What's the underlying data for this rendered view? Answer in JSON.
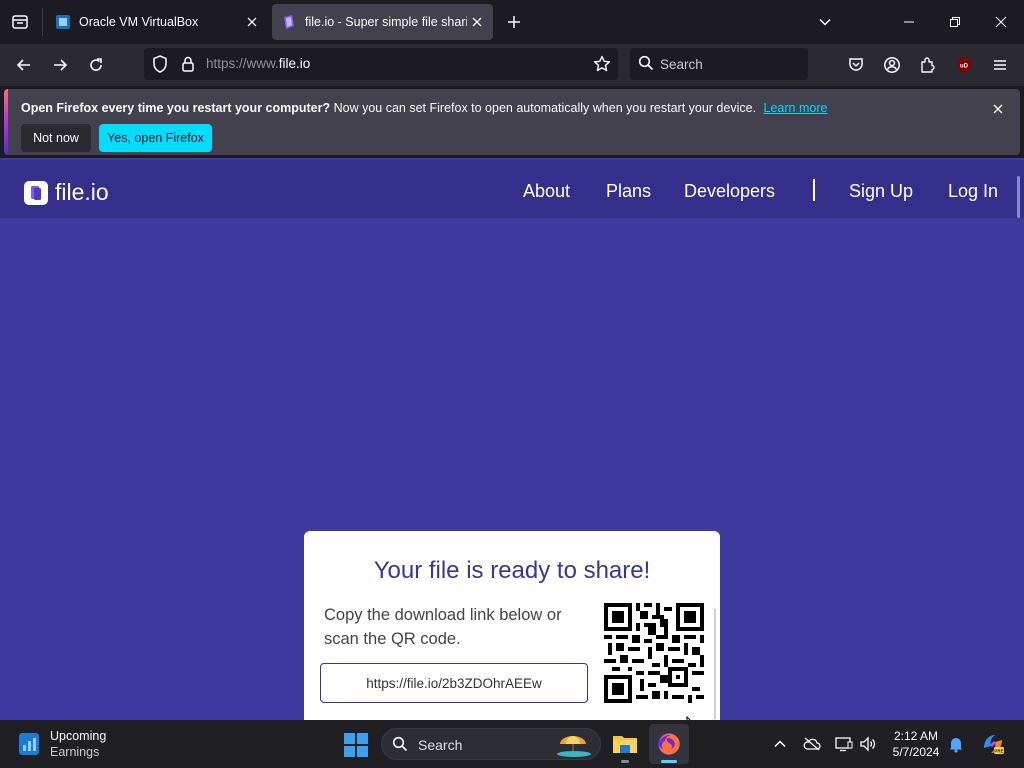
{
  "browser": {
    "tabs": [
      {
        "title": "Oracle VM VirtualBox",
        "active": false
      },
      {
        "title": "file.io - Super simple file sharing",
        "active": true
      }
    ],
    "url": {
      "scheme": "https://www.",
      "host": "file.io"
    },
    "search_placeholder": "Search"
  },
  "notification": {
    "bold": "Open Firefox every time you restart your computer?",
    "text": "Now you can set Firefox to open automatically when you restart your device.",
    "link": "Learn more",
    "buttons": {
      "not_now": "Not now",
      "yes": "Yes, open Firefox"
    }
  },
  "site": {
    "logo": "file.io",
    "nav": [
      "About",
      "Plans",
      "Developers",
      "Sign Up",
      "Log In"
    ]
  },
  "card": {
    "title": "Your file is ready to share!",
    "description": "Copy the download link below or scan the QR code.",
    "link": "https://file.io/2b3ZDOhrAEEw"
  },
  "taskbar": {
    "widget_title": "Upcoming",
    "widget_subtitle": "Earnings",
    "search_label": "Search",
    "time": "2:12 AM",
    "date": "5/7/2024"
  },
  "colors": {
    "page_bg": "#3e3a9f",
    "header_bg": "#342f8a",
    "card_title": "#3b3694",
    "accent_button": "#00ddff"
  }
}
